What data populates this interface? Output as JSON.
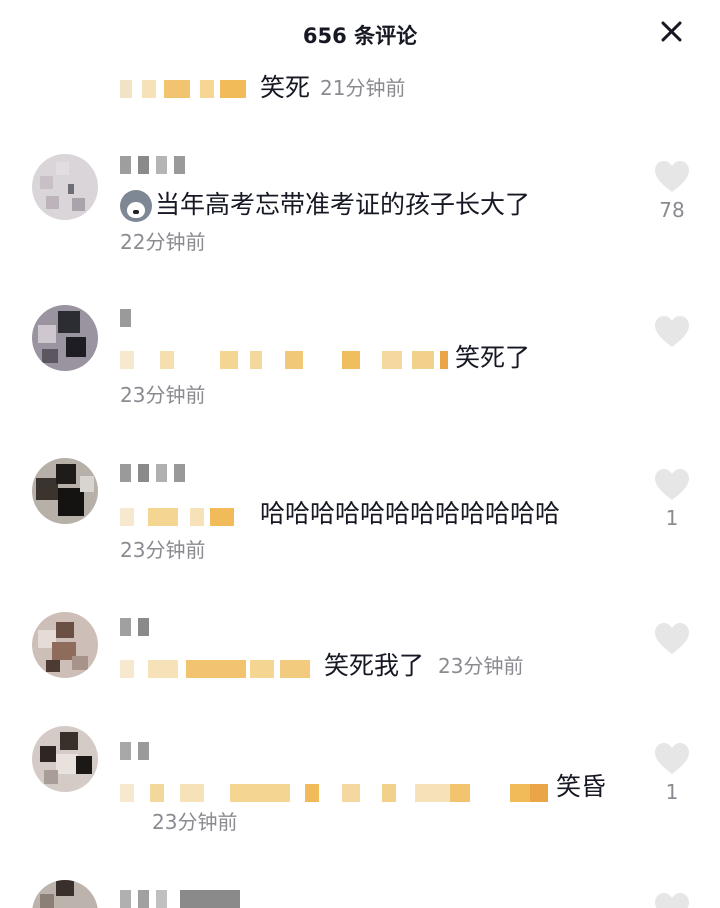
{
  "header": {
    "title": "656 条评论",
    "close_icon": "close-icon"
  },
  "comments": [
    {
      "text": "笑死",
      "time": "21分钟前"
    },
    {
      "text": "当年高考忘带准考证的孩子长大了",
      "time": "22分钟前",
      "likes": "78",
      "emoji": "husky-emoji"
    },
    {
      "text": "笑死了",
      "time": "23分钟前"
    },
    {
      "text": "哈哈哈哈哈哈哈哈哈哈哈哈",
      "time": "23分钟前",
      "likes": "1"
    },
    {
      "text": "笑死我了",
      "time": "23分钟前"
    },
    {
      "text": "笑昏",
      "time": "23分钟前",
      "likes": "1"
    }
  ],
  "colors": {
    "text": "#161823",
    "secondary": "#8a8b91",
    "heart": "#e6e6e6"
  }
}
